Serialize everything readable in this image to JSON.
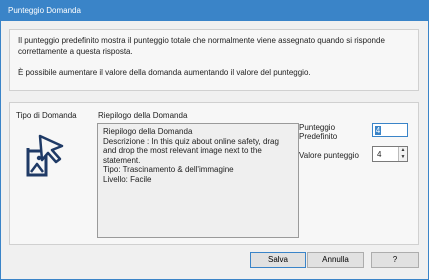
{
  "window": {
    "title": "Punteggio Domanda"
  },
  "info": {
    "line1": "Il punteggio predefinito mostra il punteggio totale che normalmente viene assegnato quando si risponde",
    "line2": "correttamente a questa risposta.",
    "line3": "È possibile aumentare il valore della domanda aumentando il valore del punteggio."
  },
  "question_type": {
    "label": "Tipo di Domanda",
    "icon": "drag-drop-image-icon"
  },
  "summary": {
    "header": "Riepilogo della Domanda",
    "title": "Riepilogo della Domanda",
    "description": "Descrizione : In this quiz about online safety, drag and drop the most relevant image next to the statement.",
    "type": "Tipo: Trascinamento & dell'immagine",
    "level": "Livello: Facile"
  },
  "score": {
    "label": "Punteggio Predefinito",
    "value": "4"
  },
  "value_score": {
    "label": "Valore punteggio",
    "value": "4"
  },
  "buttons": {
    "save": "Salva",
    "cancel": "Annulla",
    "help": "?"
  },
  "colors": {
    "accent": "#3a84c8",
    "icon": "#1f3a66"
  }
}
